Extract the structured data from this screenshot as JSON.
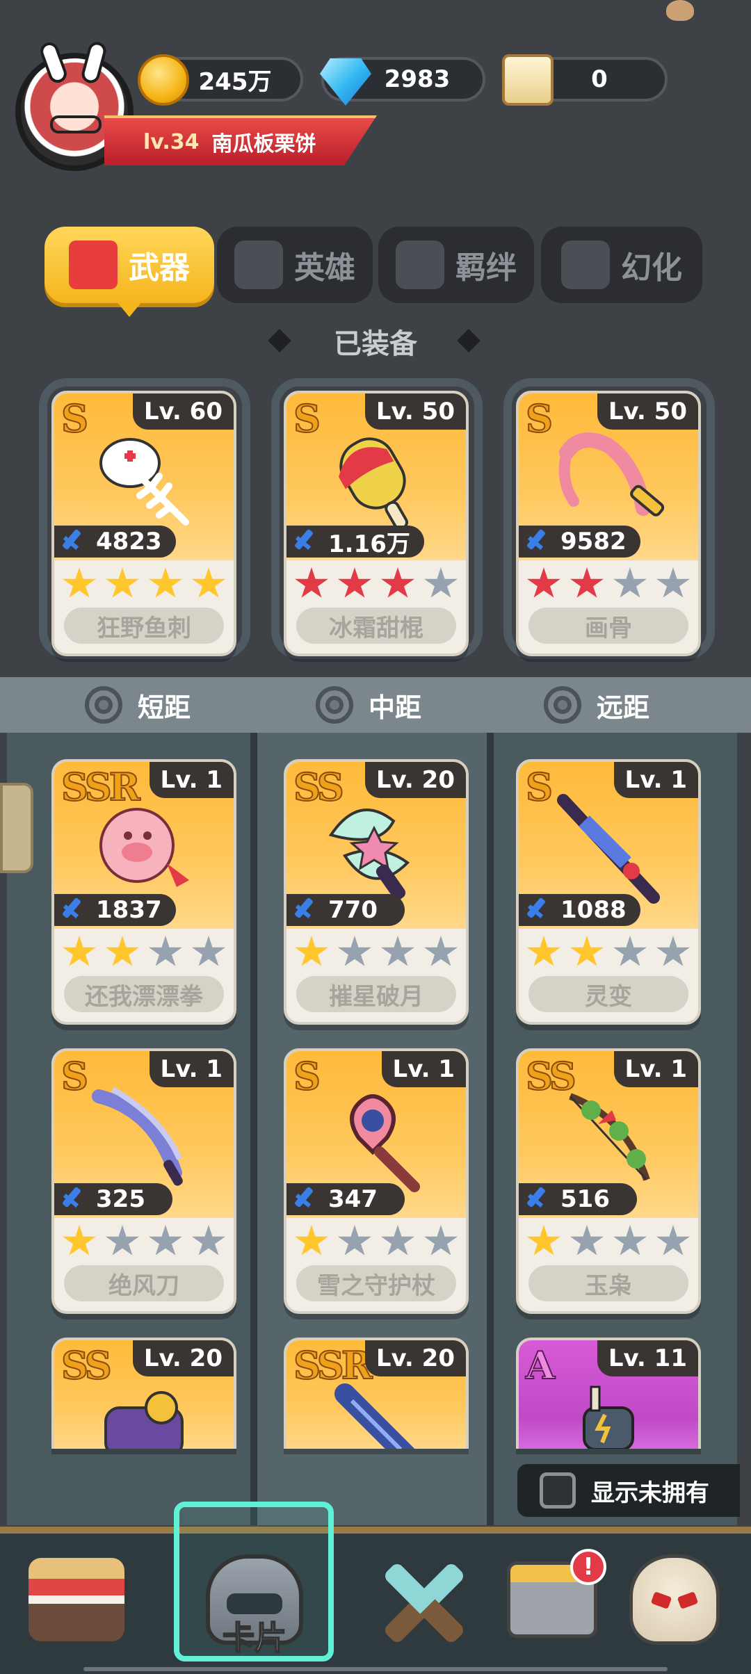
{
  "profile": {
    "level_label": "lv.34",
    "name": "南瓜板栗饼"
  },
  "currencies": [
    {
      "icon": "gold-coin-icon",
      "value": "245万"
    },
    {
      "icon": "diamond-gem-icon",
      "value": "2983"
    },
    {
      "icon": "scroll-icon",
      "value": "0"
    }
  ],
  "tabs": [
    {
      "label": "武器",
      "icon": "weapon-icon",
      "active": true
    },
    {
      "label": "英雄",
      "icon": "hero-icon",
      "active": false
    },
    {
      "label": "羁绊",
      "icon": "bond-icon",
      "active": false
    },
    {
      "label": "幻化",
      "icon": "transform-icon",
      "active": false
    }
  ],
  "equipped_title": "已装备",
  "equipped": [
    {
      "rank": "S",
      "level": "Lv. 60",
      "power": "4823",
      "stars": 4,
      "star_color": "yellow",
      "name": "狂野鱼刺"
    },
    {
      "rank": "S",
      "level": "Lv. 50",
      "power": "1.16万",
      "stars": 3,
      "star_color": "red",
      "name": "冰霜甜棍"
    },
    {
      "rank": "S",
      "level": "Lv. 50",
      "power": "9582",
      "stars": 2,
      "star_color": "red",
      "name": "画骨"
    }
  ],
  "ranges": [
    {
      "label": "短距"
    },
    {
      "label": "中距"
    },
    {
      "label": "远距"
    }
  ],
  "inventory": [
    {
      "rank": "SSR",
      "level": "Lv. 1",
      "power": "1837",
      "stars": 2,
      "name": "还我漂漂拳"
    },
    {
      "rank": "SS",
      "level": "Lv. 20",
      "power": "770",
      "stars": 1,
      "name": "摧星破月"
    },
    {
      "rank": "S",
      "level": "Lv. 1",
      "power": "1088",
      "stars": 2,
      "name": "灵变"
    },
    {
      "rank": "S",
      "level": "Lv. 1",
      "power": "325",
      "stars": 1,
      "name": "绝风刀"
    },
    {
      "rank": "S",
      "level": "Lv. 1",
      "power": "347",
      "stars": 1,
      "name": "雪之守护杖"
    },
    {
      "rank": "SS",
      "level": "Lv. 1",
      "power": "516",
      "stars": 1,
      "name": "玉枭"
    },
    {
      "rank": "SS",
      "level": "Lv. 20"
    },
    {
      "rank": "SSR",
      "level": "Lv. 20"
    },
    {
      "rank": "A",
      "level": "Lv. 11"
    }
  ],
  "show_unowned_label": "显示未拥有",
  "bottom_nav": {
    "card_label": "卡片",
    "badge": "!"
  },
  "colors": {
    "background": "#3e4247",
    "tab_active": "#f5b51d",
    "star_yellow": "#ffc72c",
    "star_red": "#e23b47",
    "star_gray": "#97a2b0"
  }
}
